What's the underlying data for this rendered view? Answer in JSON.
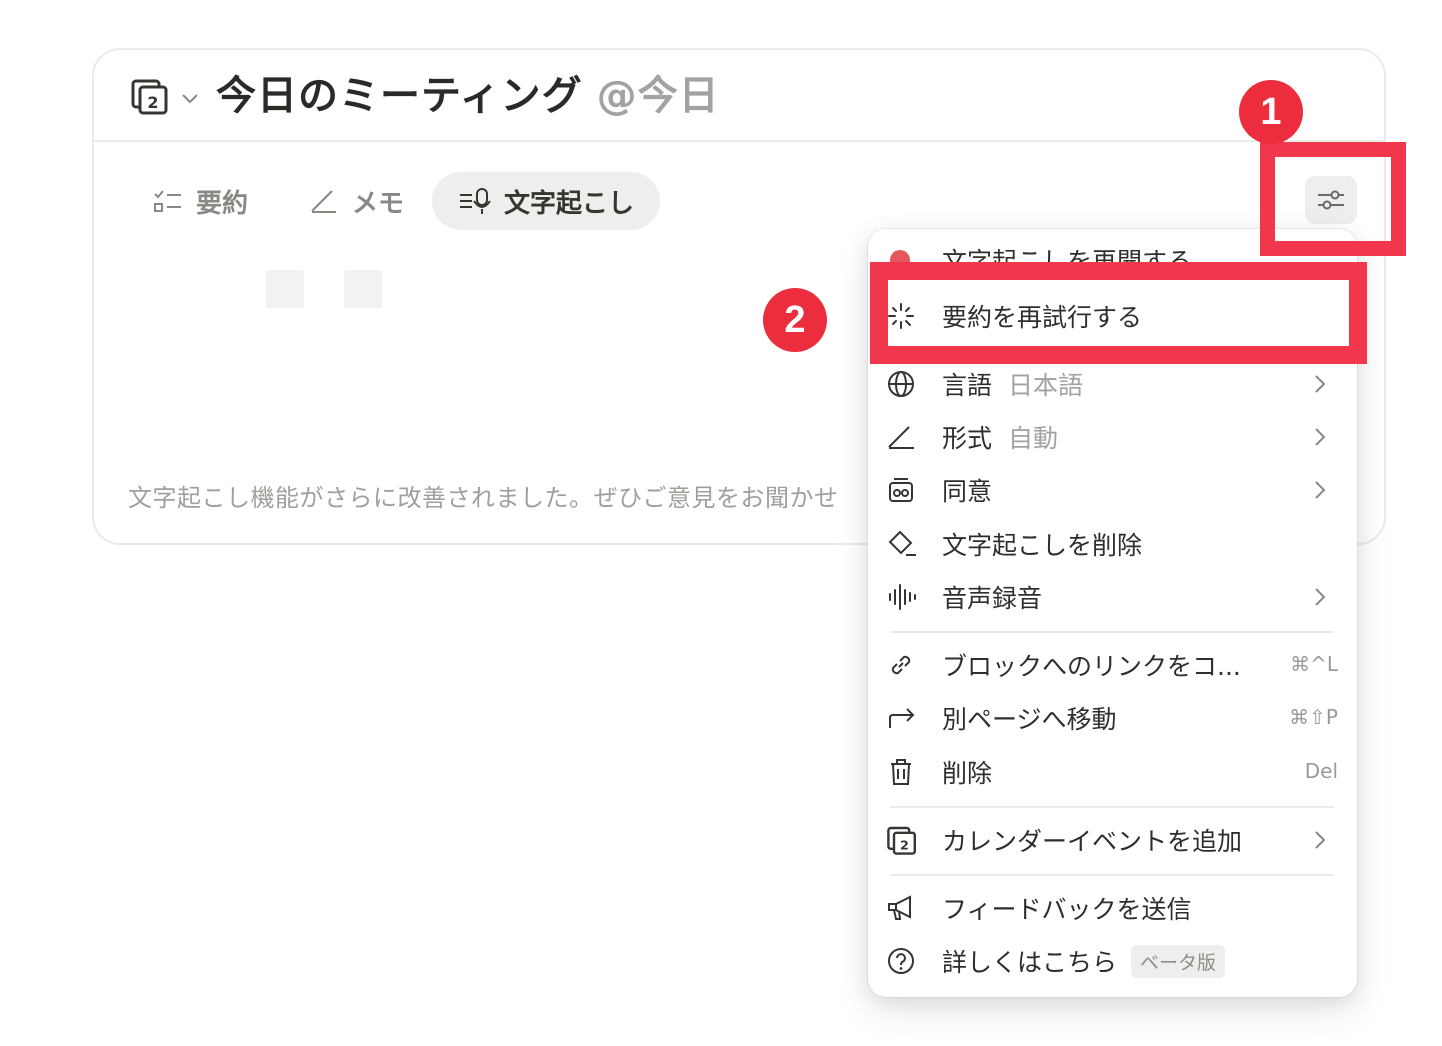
{
  "block": {
    "title": "今日のミーティング",
    "mention": "@今日",
    "tabs": [
      {
        "label": "要約",
        "icon": "checklist-icon",
        "active": false
      },
      {
        "label": "メモ",
        "icon": "pen-icon",
        "active": false
      },
      {
        "label": "文字起こし",
        "icon": "transcript-mic-icon",
        "active": true
      }
    ],
    "notice": "文字起こし機能がさらに改善されました。ぜひご意見をお聞かせ"
  },
  "menu": {
    "items": [
      {
        "label": "文字起こしを再開する",
        "icon": "record-dot-icon",
        "submenu": false
      },
      {
        "label": "要約を再試行する",
        "icon": "sparkle-icon",
        "submenu": false
      },
      {
        "label": "言語",
        "value": "日本語",
        "icon": "globe-icon",
        "submenu": true
      },
      {
        "label": "形式",
        "value": "自動",
        "icon": "pen-icon",
        "submenu": true
      },
      {
        "label": "同意",
        "icon": "consent-icon",
        "submenu": true
      },
      {
        "label": "文字起こしを削除",
        "icon": "eraser-icon",
        "submenu": false
      },
      {
        "label": "音声録音",
        "icon": "waveform-icon",
        "submenu": true
      },
      {
        "label": "ブロックへのリンクをコ...",
        "icon": "link-icon",
        "shortcut": "⌘^L"
      },
      {
        "label": "別ページへ移動",
        "icon": "move-arrow-icon",
        "shortcut": "⌘⇧P"
      },
      {
        "label": "削除",
        "icon": "trash-icon",
        "shortcut": "Del"
      },
      {
        "label": "カレンダーイベントを追加",
        "icon": "calendar-icon",
        "submenu": true
      },
      {
        "label": "フィードバックを送信",
        "icon": "megaphone-icon",
        "submenu": false
      },
      {
        "label": "詳しくはこちら",
        "badge": "ベータ版",
        "icon": "help-icon",
        "submenu": false
      }
    ]
  },
  "annotations": {
    "step1": "1",
    "step2": "2",
    "highlight_color": "#f0374b"
  }
}
